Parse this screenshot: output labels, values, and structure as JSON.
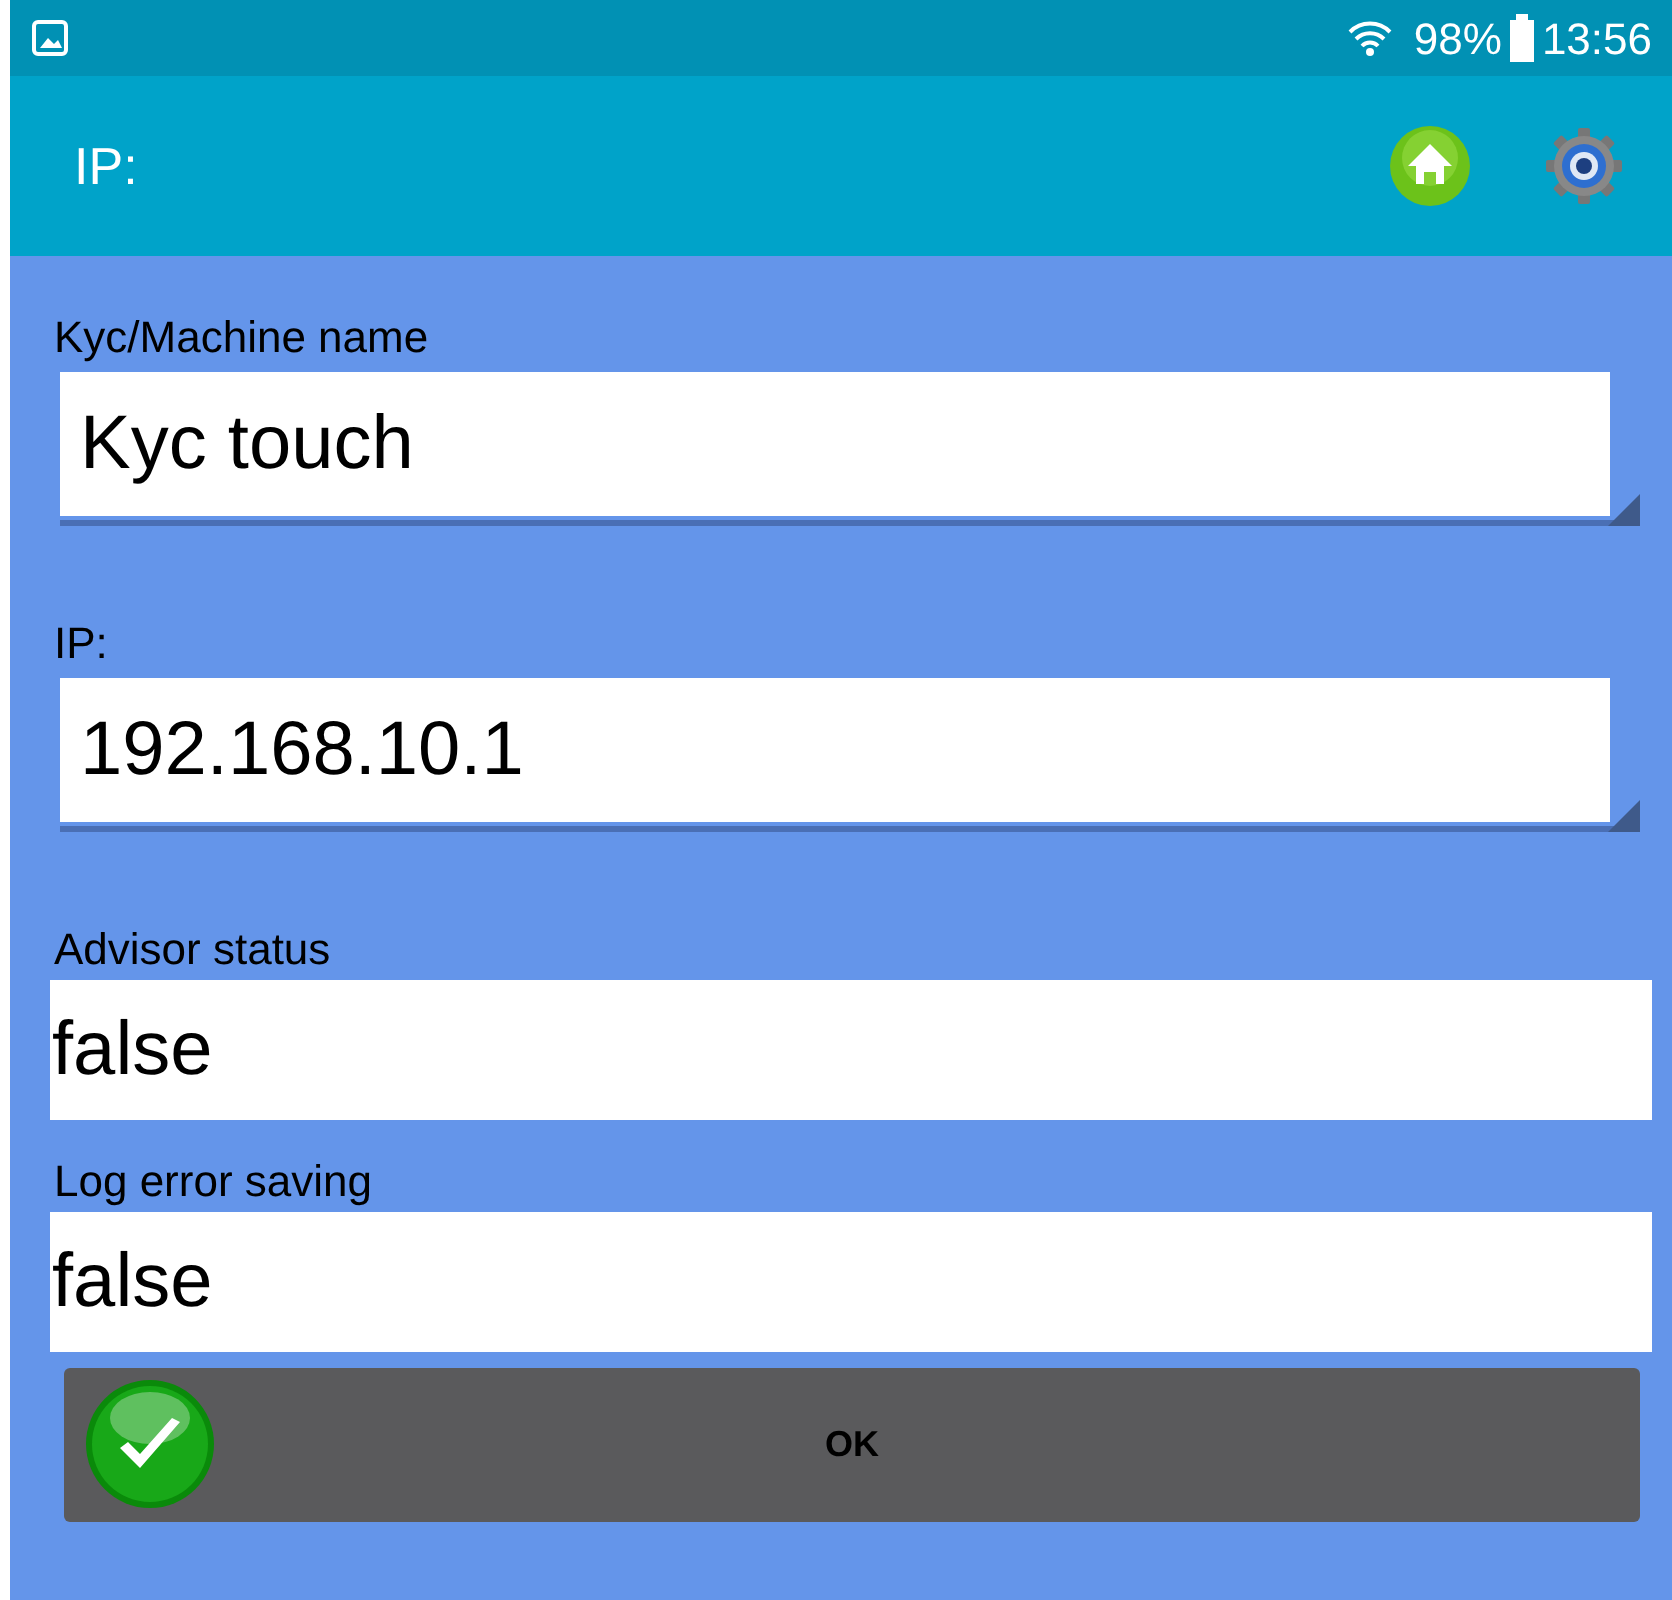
{
  "status_bar": {
    "battery": "98%",
    "time": "13:56"
  },
  "app_bar": {
    "title": "IP:"
  },
  "fields": [
    {
      "kind": "spinner",
      "label": "Kyc/Machine name",
      "value": "Kyc touch"
    },
    {
      "kind": "spinner",
      "label": "IP:",
      "value": "192.168.10.1"
    },
    {
      "kind": "text",
      "label": "Advisor status",
      "value": "false"
    },
    {
      "kind": "text",
      "label": "Log error saving",
      "value": "false"
    }
  ],
  "ok_button": {
    "label": "OK"
  }
}
